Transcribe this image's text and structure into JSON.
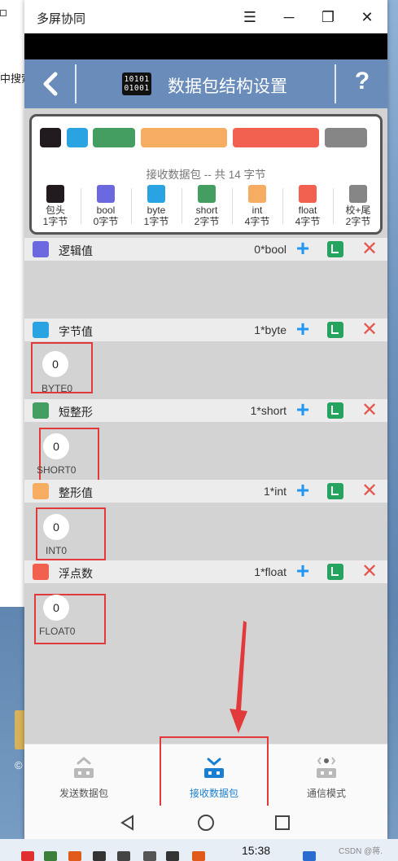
{
  "window": {
    "title": "多屏协同",
    "min_glyph": "☰",
    "max_glyph": "─",
    "restore_glyph": "❐",
    "close_glyph": "✕"
  },
  "behind": {
    "text": "中搜索"
  },
  "desktop": {
    "copy_text": "©"
  },
  "header": {
    "title": "数据包结构设置",
    "icon_text_line1": "10101",
    "icon_text_line2": "01001",
    "help": "?"
  },
  "summary": {
    "text": "接收数据包 -- 共 14 字节",
    "bar_colors": [
      "#231a1f",
      "#2aa3e3",
      "#449e62",
      "#f6ad62",
      "#f2614f",
      "#868686"
    ],
    "legend": [
      {
        "name": "包头",
        "bytes": "1字节",
        "color": "#231a1f"
      },
      {
        "name": "bool",
        "bytes": "0字节",
        "color": "#6b68e0"
      },
      {
        "name": "byte",
        "bytes": "1字节",
        "color": "#2aa3e3"
      },
      {
        "name": "short",
        "bytes": "2字节",
        "color": "#449e62"
      },
      {
        "name": "int",
        "bytes": "4字节",
        "color": "#f6ad62"
      },
      {
        "name": "float",
        "bytes": "4字节",
        "color": "#f2614f"
      },
      {
        "name": "校+尾",
        "bytes": "2字节",
        "color": "#868686"
      }
    ]
  },
  "sections": [
    {
      "label": "逻辑值",
      "count": "0*bool",
      "color": "#6b68e0",
      "item": null
    },
    {
      "label": "字节值",
      "count": "1*byte",
      "color": "#2aa3e3",
      "item": {
        "value": "0",
        "name": "BYTE0"
      }
    },
    {
      "label": "短整形",
      "count": "1*short",
      "color": "#449e62",
      "item": {
        "value": "0",
        "name": "SHORT0"
      }
    },
    {
      "label": "整形值",
      "count": "1*int",
      "color": "#f6ad62",
      "item": {
        "value": "0",
        "name": "INT0"
      }
    },
    {
      "label": "浮点数",
      "count": "1*float",
      "color": "#f2614f",
      "item": {
        "value": "0",
        "name": "FLOAT0"
      }
    }
  ],
  "section_actions": {
    "plus": "+",
    "close": "✕"
  },
  "bottom_nav": [
    {
      "label": "发送数据包",
      "active": false
    },
    {
      "label": "接收数据包",
      "active": true
    },
    {
      "label": "通信模式",
      "active": false
    }
  ],
  "taskbar": {
    "time": "15:38",
    "watermark": "CSDN @蒋."
  },
  "colors": {
    "header": "#6a8cbb",
    "active": "#1a7fd1",
    "inactive": "#555555",
    "highlight": "#e23a3a"
  }
}
